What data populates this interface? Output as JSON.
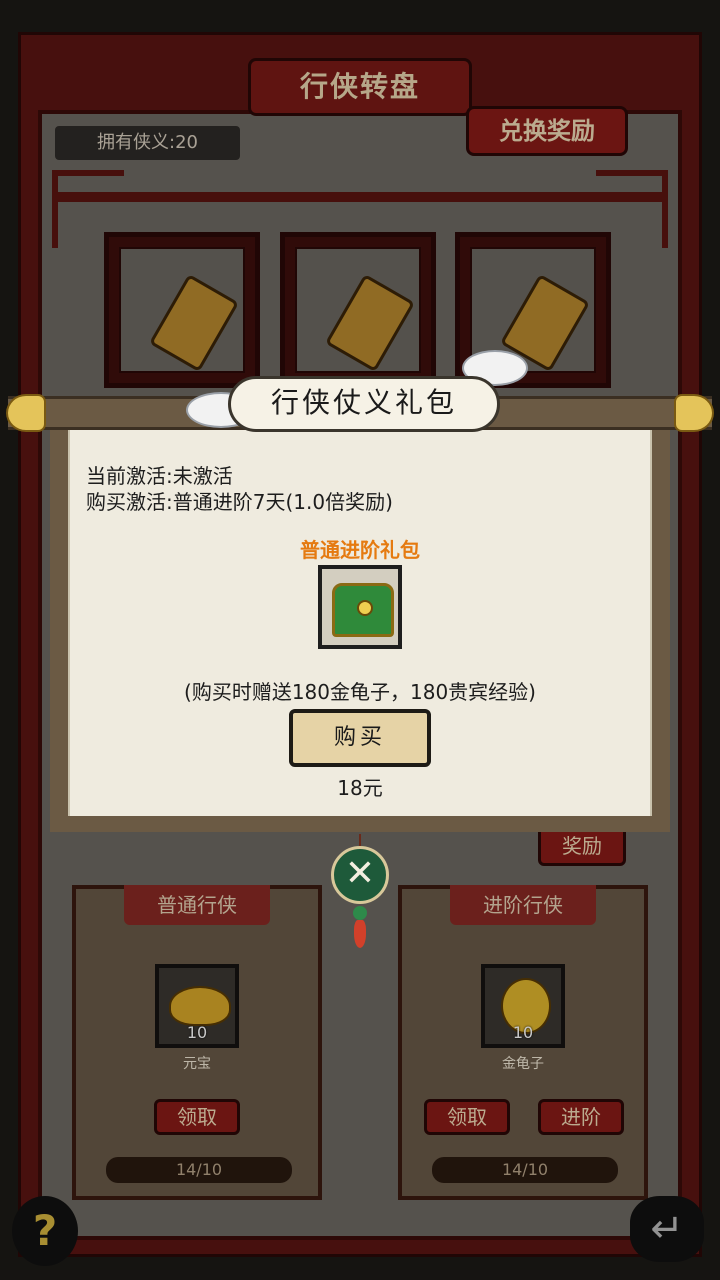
{
  "screen": {
    "title": "行侠转盘",
    "xiayi_label": "拥有侠义:20",
    "exchange_button": "兑换奖励",
    "reward_button": "奖励"
  },
  "panels": [
    {
      "title": "普通行侠",
      "reward_name": "元宝",
      "reward_count": "10",
      "buttons": [
        "领取"
      ],
      "progress": "14/10"
    },
    {
      "title": "进阶行侠",
      "reward_name": "金龟子",
      "reward_count": "10",
      "buttons": [
        "领取",
        "进阶"
      ],
      "progress": "14/10"
    }
  ],
  "modal": {
    "title": "行侠仗义礼包",
    "current_activation": "当前激活:未激活",
    "buy_activation": "购买激活:普通进阶7天(1.0倍奖励)",
    "pack_name": "普通进阶礼包",
    "bonus_text": "(购买时赠送180金龟子，180贵宾经验)",
    "buy_button": "购买",
    "price": "18元",
    "close_icon": "crossed-swords-icon"
  },
  "icons": {
    "help": "?",
    "back": "↵"
  },
  "colors": {
    "frame": "#5c1513",
    "modal_paper": "#efebdf",
    "pack_name": "#e57a10",
    "close_button": "#1e5a3a"
  }
}
